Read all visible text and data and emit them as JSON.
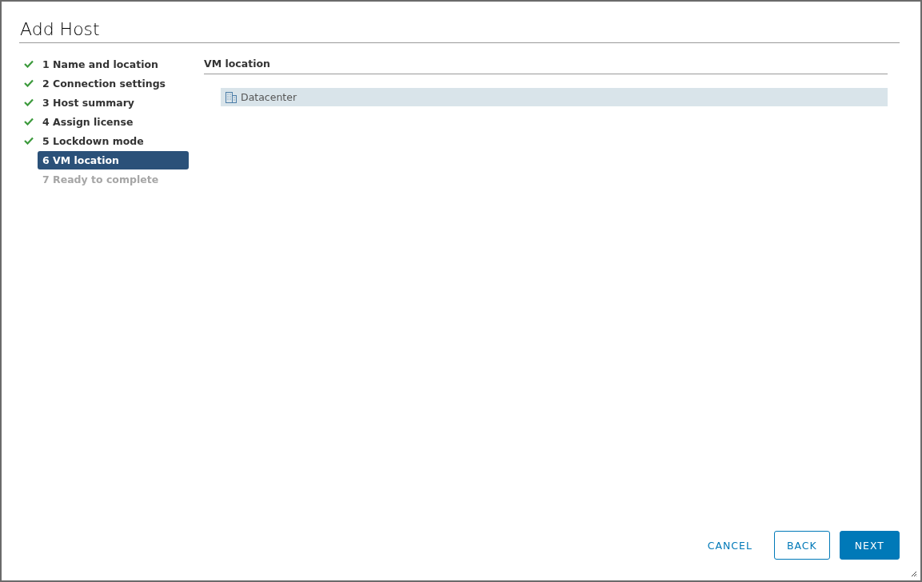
{
  "dialog": {
    "title": "Add Host"
  },
  "steps": [
    {
      "label": "1 Name and location",
      "completed": true,
      "disabled": false,
      "selected": false
    },
    {
      "label": "2 Connection settings",
      "completed": true,
      "disabled": false,
      "selected": false
    },
    {
      "label": "3 Host summary",
      "completed": true,
      "disabled": false,
      "selected": false
    },
    {
      "label": "4 Assign license",
      "completed": true,
      "disabled": false,
      "selected": false
    },
    {
      "label": "5 Lockdown mode",
      "completed": true,
      "disabled": false,
      "selected": false
    },
    {
      "label": "6 VM location",
      "completed": false,
      "disabled": false,
      "selected": true
    },
    {
      "label": "7 Ready to complete",
      "completed": false,
      "disabled": true,
      "selected": false
    }
  ],
  "content": {
    "heading": "VM location",
    "tree": [
      {
        "label": "Datacenter",
        "selected": true
      }
    ]
  },
  "buttons": [
    {
      "label": "CANCEL",
      "kind": "flat"
    },
    {
      "label": "BACK",
      "kind": "outline"
    },
    {
      "label": "NEXT",
      "kind": "primary"
    }
  ]
}
